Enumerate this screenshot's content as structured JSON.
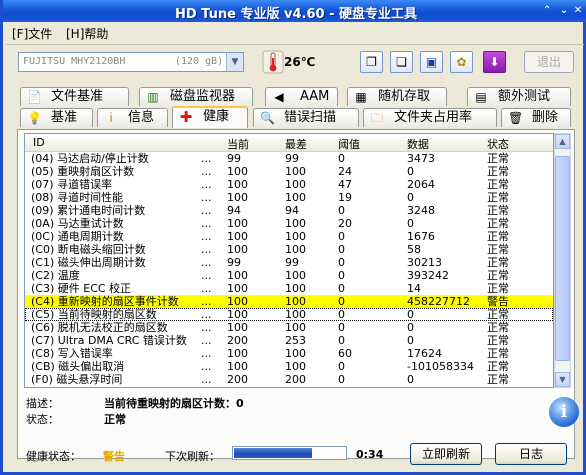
{
  "window": {
    "title": "HD Tune 专业版 v4.60 - 硬盘专业工具"
  },
  "menu": {
    "file": "[F]文件",
    "help": "[H]帮助"
  },
  "toolbar": {
    "drive_name": "FUJITSU MHY2120BH",
    "drive_size": "(120 gB)",
    "temperature": "26℃",
    "exit_label": "退出"
  },
  "tabs_top": [
    {
      "label": "文件基准",
      "icon": "file-benchmark-icon"
    },
    {
      "label": "磁盘监视器",
      "icon": "disk-monitor-icon"
    },
    {
      "label": "AAM",
      "icon": "speaker-icon"
    },
    {
      "label": "随机存取",
      "icon": "random-access-icon"
    },
    {
      "label": "额外测试",
      "icon": "extra-tests-icon"
    }
  ],
  "tabs_bottom": [
    {
      "label": "基准",
      "icon": "benchmark-icon"
    },
    {
      "label": "信息",
      "icon": "info-icon"
    },
    {
      "label": "健康",
      "icon": "health-cross-icon",
      "active": true
    },
    {
      "label": "错误扫描",
      "icon": "magnifier-icon"
    },
    {
      "label": "文件夹占用率",
      "icon": "folder-icon"
    },
    {
      "label": "删除",
      "icon": "trash-icon"
    }
  ],
  "table": {
    "columns": [
      "ID",
      "当前",
      "最差",
      "阈值",
      "数据",
      "状态"
    ],
    "rows": [
      {
        "id": "(04) 马达启动/停止计数",
        "dots": "...",
        "cur": "99",
        "worst": "99",
        "thr": "0",
        "data": "3473",
        "status": "正常"
      },
      {
        "id": "(05) 重映射扇区计数",
        "dots": "...",
        "cur": "100",
        "worst": "100",
        "thr": "24",
        "data": "0",
        "status": "正常"
      },
      {
        "id": "(07) 寻道错误率",
        "dots": "...",
        "cur": "100",
        "worst": "100",
        "thr": "47",
        "data": "2064",
        "status": "正常"
      },
      {
        "id": "(08) 寻道时间性能",
        "dots": "...",
        "cur": "100",
        "worst": "100",
        "thr": "19",
        "data": "0",
        "status": "正常"
      },
      {
        "id": "(09) 累计通电时间计数",
        "dots": "...",
        "cur": "94",
        "worst": "94",
        "thr": "0",
        "data": "3248",
        "status": "正常"
      },
      {
        "id": "(0A) 马达重试计数",
        "dots": "...",
        "cur": "100",
        "worst": "100",
        "thr": "20",
        "data": "0",
        "status": "正常"
      },
      {
        "id": "(0C) 通电周期计数",
        "dots": "...",
        "cur": "100",
        "worst": "100",
        "thr": "0",
        "data": "1676",
        "status": "正常"
      },
      {
        "id": "(C0) 断电磁头缩回计数",
        "dots": "...",
        "cur": "100",
        "worst": "100",
        "thr": "0",
        "data": "58",
        "status": "正常"
      },
      {
        "id": "(C1) 磁头伸出周期计数",
        "dots": "...",
        "cur": "99",
        "worst": "99",
        "thr": "0",
        "data": "30213",
        "status": "正常"
      },
      {
        "id": "(C2) 温度",
        "dots": "...",
        "cur": "100",
        "worst": "100",
        "thr": "0",
        "data": "393242",
        "status": "正常"
      },
      {
        "id": "(C3) 硬件 ECC 校正",
        "dots": "...",
        "cur": "100",
        "worst": "100",
        "thr": "0",
        "data": "14",
        "status": "正常"
      },
      {
        "id": "(C4) 重新映射的扇区事件计数",
        "dots": "...",
        "cur": "100",
        "worst": "100",
        "thr": "0",
        "data": "458227712",
        "status": "警告",
        "warn": true
      },
      {
        "id": "(C5) 当前待映射的扇区数",
        "dots": "...",
        "cur": "100",
        "worst": "100",
        "thr": "0",
        "data": "0",
        "status": "正常",
        "selected": true
      },
      {
        "id": "(C6) 脱机无法校正的扇区数",
        "dots": "...",
        "cur": "100",
        "worst": "100",
        "thr": "0",
        "data": "0",
        "status": "正常"
      },
      {
        "id": "(C7) Ultra DMA CRC 错误计数",
        "dots": "...",
        "cur": "200",
        "worst": "253",
        "thr": "0",
        "data": "0",
        "status": "正常"
      },
      {
        "id": "(C8) 写入错误率",
        "dots": "...",
        "cur": "100",
        "worst": "100",
        "thr": "60",
        "data": "17624",
        "status": "正常"
      },
      {
        "id": "(CB) 磁头偏出取消",
        "dots": "...",
        "cur": "100",
        "worst": "100",
        "thr": "0",
        "data": "-101058334",
        "status": "正常"
      },
      {
        "id": "(F0) 磁头悬浮时间",
        "dots": "...",
        "cur": "200",
        "worst": "200",
        "thr": "0",
        "data": "0",
        "status": "正常"
      }
    ]
  },
  "details": {
    "desc_label": "描述：",
    "desc_value": "当前待重映射的扇区计数：0",
    "status_label": "状态：",
    "status_value": "正常"
  },
  "footer": {
    "health_label": "健康状态：",
    "health_value": "警告",
    "refresh_label": "下次刷新：",
    "refresh_progress": 0.7,
    "countdown": "0:34",
    "refresh_now": "立即刷新",
    "log": "日志"
  },
  "colors": {
    "warning_row": "#ffff00",
    "title_bar": "#1457d8",
    "warning_text": "#e8a800"
  }
}
